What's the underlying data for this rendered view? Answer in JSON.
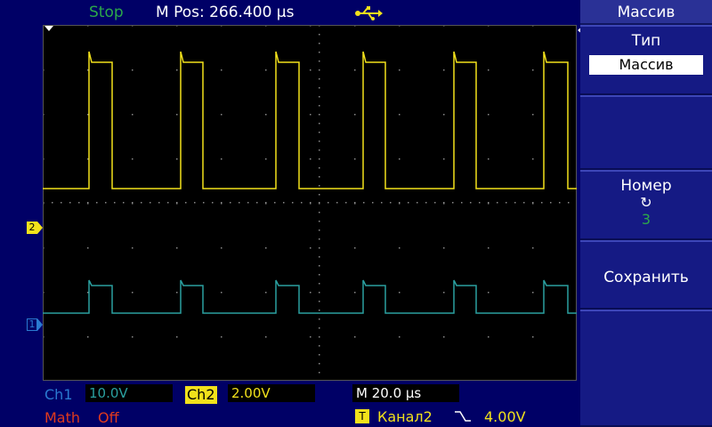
{
  "status": {
    "run_state": "Stop",
    "m_pos": "M Pos: 266.400 µs",
    "usb_icon": "usb-icon"
  },
  "channel_markers": {
    "ch2": "2",
    "ch1": "1"
  },
  "bottom": {
    "ch1_label": "Ch1",
    "ch1_value": "10.0V",
    "ch2_label": "Ch2",
    "ch2_value": "2.00V",
    "timebase": "M 20.0 µs",
    "math_label": "Math",
    "math_value": "Off",
    "trigger_badge": "T",
    "trigger_source": "Канал2",
    "trigger_slope_icon": "falling-edge-icon",
    "trigger_level": "4.00V"
  },
  "menu": {
    "title": "Массив",
    "type_label": "Тип",
    "type_value": "Массив",
    "number_label": "Номер",
    "number_icon": "cycle-icon",
    "number_value": "3",
    "save_label": "Сохранить"
  },
  "colors": {
    "background": "#000066",
    "channel1": "#2aa0a0",
    "channel2": "#f2e11b",
    "run_state": "#2ca84a",
    "math": "#e03a1e",
    "menu": "#151a84"
  }
}
